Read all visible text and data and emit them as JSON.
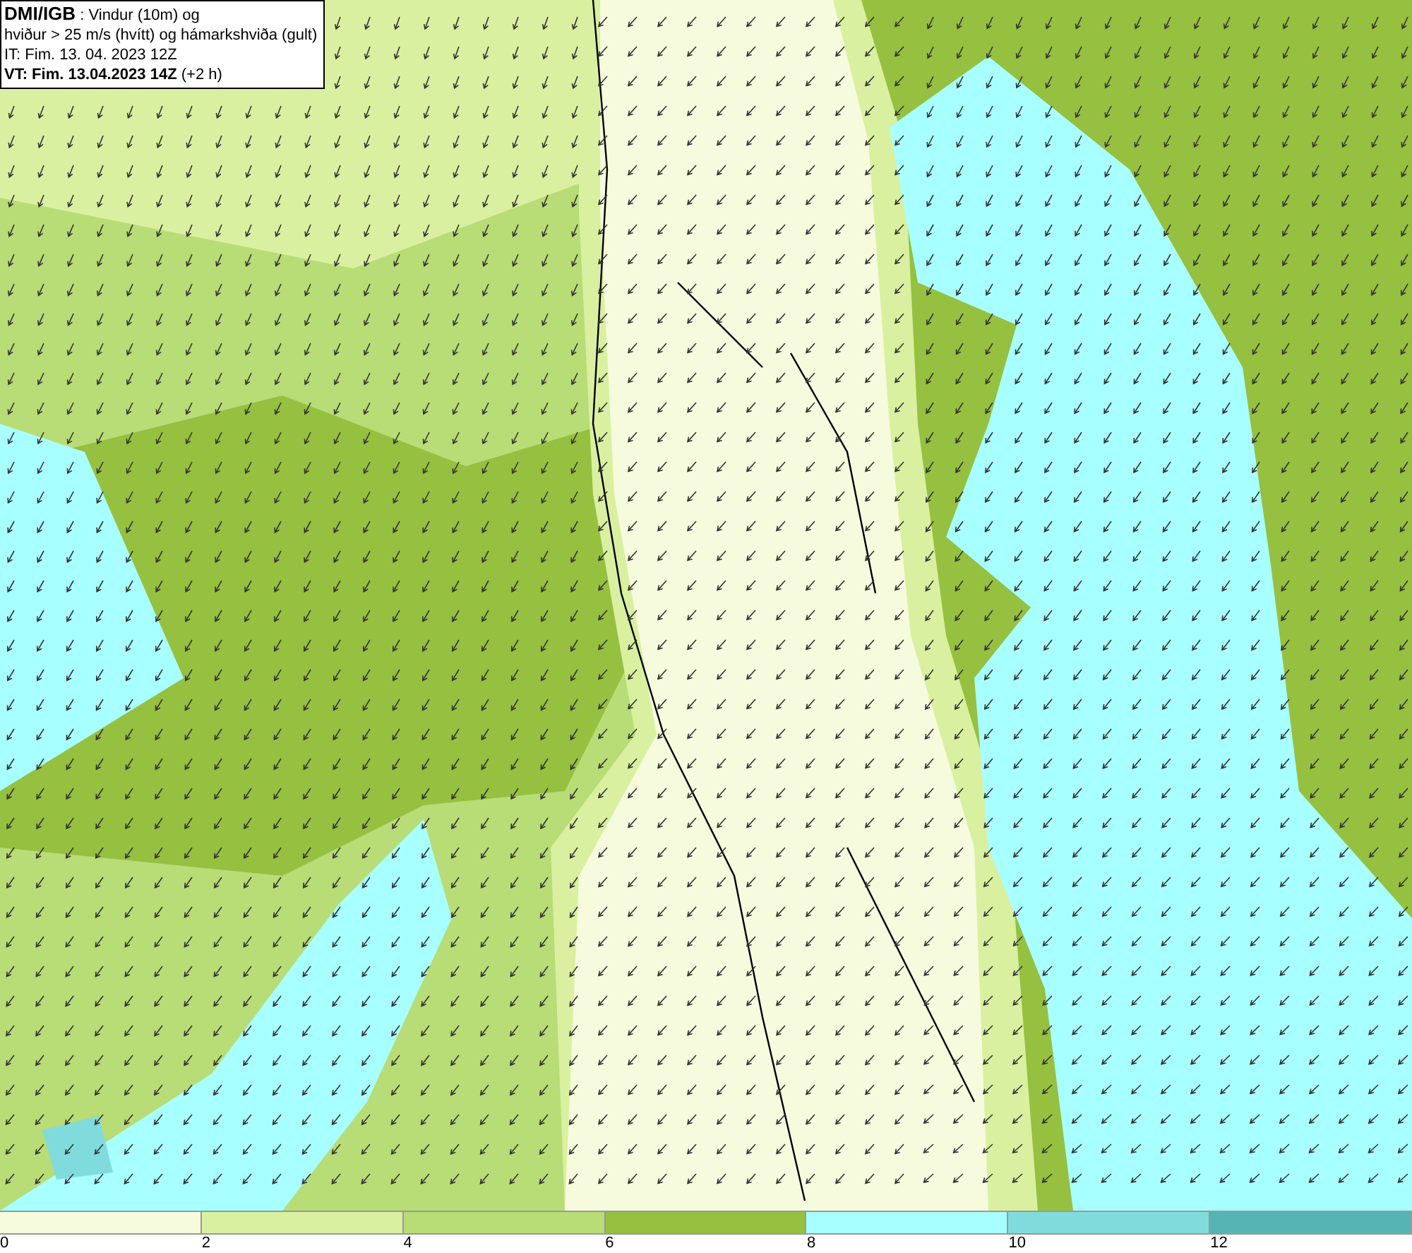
{
  "info_box": {
    "lines": [
      "**DMI/IGB** : Vindur (10m) og",
      "hviður > 25 m/s (hvítt) og hámarkshviða (gult)",
      "IT: Fim. 13. 04. 2023 12Z",
      "**VT: Fim. 13.04.2023 14Z** (+2 h)"
    ]
  },
  "legend": {
    "bins": [
      {
        "label": "0",
        "color": "#f5fbdc"
      },
      {
        "label": "2",
        "color": "#d9f0a0"
      },
      {
        "label": "4",
        "color": "#b8dc76"
      },
      {
        "label": "6",
        "color": "#96c040"
      },
      {
        "label": "8",
        "color": "#a8ffff"
      },
      {
        "label": "10",
        "color": "#80dcdc"
      },
      {
        "label": "12",
        "color": "#55b4b4"
      }
    ]
  }
}
